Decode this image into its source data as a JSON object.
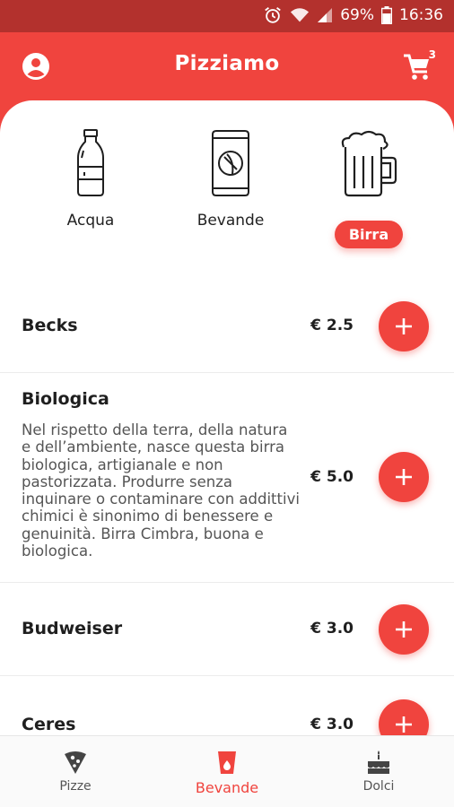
{
  "status": {
    "battery": "69%",
    "time": "16:36"
  },
  "header": {
    "title": "Pizziamo",
    "cart_count": "3"
  },
  "categories": [
    {
      "label": "Acqua",
      "icon": "water-bottle-icon"
    },
    {
      "label": "Bevande",
      "icon": "soda-can-icon"
    },
    {
      "label": "Birra",
      "icon": "beer-mug-icon",
      "selected": true
    }
  ],
  "products": [
    {
      "name": "Becks",
      "description": "",
      "price": "€ 2.5"
    },
    {
      "name": "Biologica",
      "description": "Nel rispetto della terra, della natura e dell’ambiente, nasce questa birra biologica, artigianale e non pastorizzata. Produrre senza inquinare o contaminare con addittivi chimici è sinonimo di benessere e genuinità. Birra Cimbra, buona e biologica.",
      "price": "€ 5.0"
    },
    {
      "name": "Budweiser",
      "description": "",
      "price": "€ 3.0"
    },
    {
      "name": "Ceres",
      "description": "",
      "price": "€ 3.0"
    }
  ],
  "bottom_nav": [
    {
      "label": "Pizze",
      "icon": "pizza-slice-icon"
    },
    {
      "label": "Bevande",
      "icon": "drink-cup-icon",
      "active": true
    },
    {
      "label": "Dolci",
      "icon": "cake-icon"
    }
  ],
  "colors": {
    "primary": "#f0443e",
    "statusbar": "#b3312d"
  }
}
